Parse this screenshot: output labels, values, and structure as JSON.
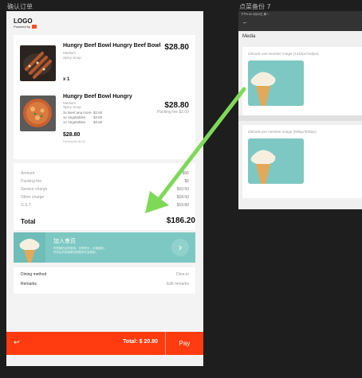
{
  "frames": {
    "left_label": "确认订单",
    "right_label": "点菜备份 7"
  },
  "header": {
    "logo": "LOGO",
    "powered_by": "Powered by"
  },
  "items": [
    {
      "name": "Hungry Beef Bowl Hungry Beef Bowl",
      "variant": "Medium",
      "option": "Spicy Soup",
      "price": "$28.80",
      "qty": "x 1"
    },
    {
      "name": "Hungry Beef Bowl Hungry",
      "variant": "Medium",
      "option": "Spicy Soup",
      "price": "$28.80",
      "packing_fee": "Packing fee $2.00",
      "addons": [
        {
          "name": "3x Beef ana more",
          "price": "$2.60"
        },
        {
          "name": "1x Vegetables",
          "price": "$3.80"
        },
        {
          "name": "1x Vegetables",
          "price": "$3.80"
        }
      ],
      "subtotal": "$28.80",
      "subtotal_note": "Packing fee $2.00"
    }
  ],
  "charges": [
    {
      "label": "Amount",
      "value": "$56"
    },
    {
      "label": "Packing fee",
      "value": "$0"
    },
    {
      "label": "Service charge",
      "value": "$10.50"
    },
    {
      "label": "Other charge",
      "value": "$18.00"
    },
    {
      "label": "G.S.T.",
      "value": "$19.80"
    }
  ],
  "total": {
    "label": "Total",
    "value": "$186.20"
  },
  "banner": {
    "title": "加入會员",
    "desc_line1": "同意解约后有邀请，优享积分，价值福利。",
    "desc_line2": "任何会员资格服务按照条件及规则。"
  },
  "details": [
    {
      "label": "Dining method",
      "value": "Dine-in"
    },
    {
      "label": "Remarks",
      "value": "Edit remarks"
    }
  ],
  "bottom_bar": {
    "back_icon": "↩",
    "total_text": "Total: $ 20.80",
    "pay_label": "Pay"
  },
  "settings_screen": {
    "status_bar": "下午9:30  3月22日 周一",
    "back_icon": "←",
    "section_title": "Media",
    "use_member_caption": "ZiiKiosk use member image  (1410px*240px)",
    "join_member_caption": "ZiiKiosk join member image  (590px*820px)"
  },
  "colors": {
    "accent": "#ff3b0f",
    "banner": "#7ec8c3",
    "annotation_arrow": "#7ed957"
  }
}
